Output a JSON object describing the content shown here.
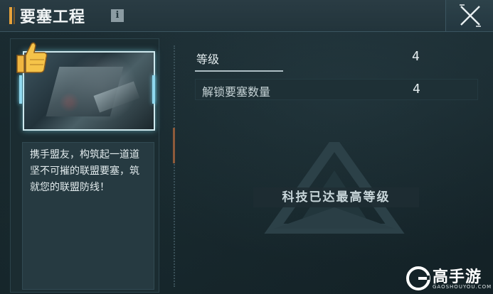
{
  "header": {
    "title": "要塞工程",
    "info_label": "i"
  },
  "left": {
    "description": "携手盟友，构筑起一道道坚不可摧的联盟要塞，筑就您的联盟防线！"
  },
  "stats": [
    {
      "label": "等级",
      "value": "4"
    },
    {
      "label": "解锁要塞数量",
      "value": "4"
    }
  ],
  "status": {
    "max_level_text": "科技已达最高等级"
  },
  "watermark": {
    "name": "高手游",
    "url": "GAOSHOUYOU.COM"
  },
  "icons": {
    "close": "close-icon",
    "info": "info-icon",
    "thumb": "thumbs-up-icon",
    "emblem": "alliance-emblem-icon"
  },
  "colors": {
    "accent": "#e6a23b",
    "frame_glow": "#8fd8ee",
    "background": "#18272c"
  }
}
